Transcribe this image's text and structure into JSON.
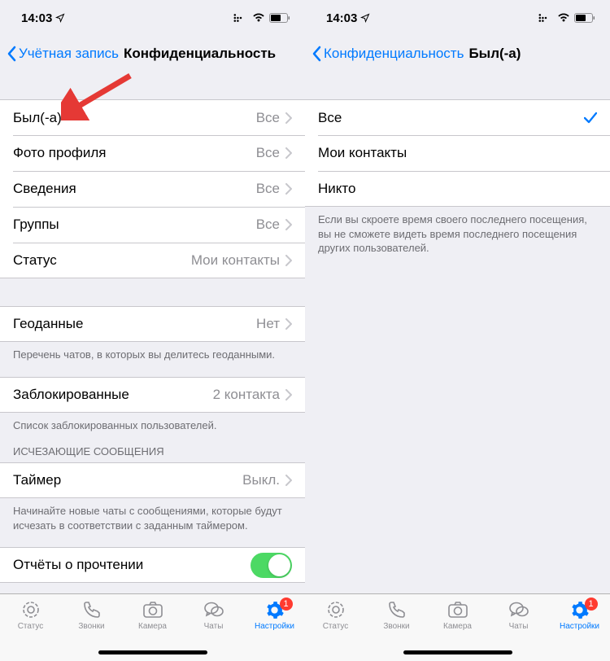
{
  "statusbar": {
    "time": "14:03"
  },
  "left": {
    "nav": {
      "back": "Учётная запись",
      "title": "Конфиденциальность"
    },
    "group1": [
      {
        "label": "Был(-а)",
        "value": "Все"
      },
      {
        "label": "Фото профиля",
        "value": "Все"
      },
      {
        "label": "Сведения",
        "value": "Все"
      },
      {
        "label": "Группы",
        "value": "Все"
      },
      {
        "label": "Статус",
        "value": "Мои контакты"
      }
    ],
    "geo": {
      "label": "Геоданные",
      "value": "Нет",
      "footer": "Перечень чатов, в которых вы делитесь геоданными."
    },
    "blocked": {
      "label": "Заблокированные",
      "value": "2 контакта",
      "footer": "Список заблокированных пользователей."
    },
    "disappearing": {
      "header": "ИСЧЕЗАЮЩИЕ СООБЩЕНИЯ",
      "label": "Таймер",
      "value": "Выкл.",
      "footer": "Начинайте новые чаты с сообщениями, которые будут исчезать в соответствии с заданным таймером."
    },
    "readreceipts": {
      "label": "Отчёты о прочтении"
    }
  },
  "right": {
    "nav": {
      "back": "Конфиденциальность",
      "title": "Был(-а)"
    },
    "options": [
      {
        "label": "Все",
        "selected": true
      },
      {
        "label": "Мои контакты",
        "selected": false
      },
      {
        "label": "Никто",
        "selected": false
      }
    ],
    "footer": "Если вы скроете время своего последнего посещения, вы не сможете видеть время последнего посещения других пользователей."
  },
  "tabs": {
    "status": "Статус",
    "calls": "Звонки",
    "camera": "Камера",
    "chats": "Чаты",
    "settings": "Настройки",
    "badge": "1"
  }
}
